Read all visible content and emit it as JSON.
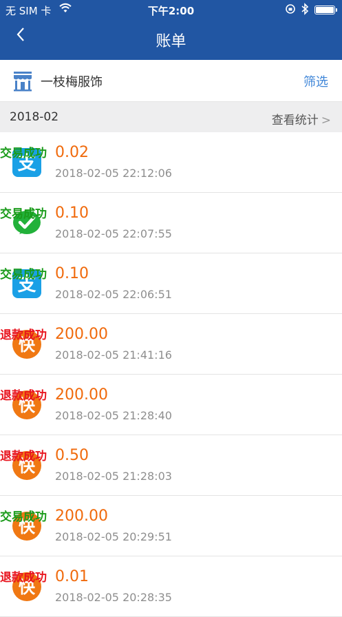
{
  "status_bar": {
    "carrier": "无 SIM 卡",
    "time": "下午2:00"
  },
  "nav": {
    "title": "账单",
    "back_icon": "chevron-left-icon"
  },
  "shop": {
    "icon": "store-icon",
    "name": "一枝梅服饰",
    "filter_label": "筛选"
  },
  "month": {
    "label": "2018-02",
    "stats_label": "查看统计"
  },
  "colors": {
    "header": "#2156a3",
    "amount": "#f06a0c",
    "success": "#1a9b1a",
    "refund": "#e8141e",
    "link": "#3f86d8"
  },
  "transactions": [
    {
      "channel": "alipay",
      "amount": "0.02",
      "time": "2018-02-05 22:12:06",
      "status": "交易成功",
      "status_type": "success"
    },
    {
      "channel": "wechat",
      "amount": "0.10",
      "time": "2018-02-05 22:07:55",
      "status": "交易成功",
      "status_type": "success"
    },
    {
      "channel": "alipay",
      "amount": "0.10",
      "time": "2018-02-05 22:06:51",
      "status": "交易成功",
      "status_type": "success"
    },
    {
      "channel": "quickpay",
      "amount": "200.00",
      "time": "2018-02-05 21:41:16",
      "status": "退款成功",
      "status_type": "refund"
    },
    {
      "channel": "quickpay",
      "amount": "200.00",
      "time": "2018-02-05 21:28:40",
      "status": "退款成功",
      "status_type": "refund"
    },
    {
      "channel": "quickpay",
      "amount": "0.50",
      "time": "2018-02-05 21:28:03",
      "status": "退款成功",
      "status_type": "refund"
    },
    {
      "channel": "quickpay",
      "amount": "200.00",
      "time": "2018-02-05 20:29:51",
      "status": "交易成功",
      "status_type": "success"
    },
    {
      "channel": "quickpay",
      "amount": "0.01",
      "time": "2018-02-05 20:28:35",
      "status": "退款成功",
      "status_type": "refund"
    }
  ],
  "icons": {
    "alipay": {
      "name": "alipay-icon",
      "glyph": "支"
    },
    "wechat": {
      "name": "wechat-pay-icon",
      "glyph": ""
    },
    "quickpay": {
      "name": "quickpay-icon",
      "glyph": "快"
    }
  }
}
